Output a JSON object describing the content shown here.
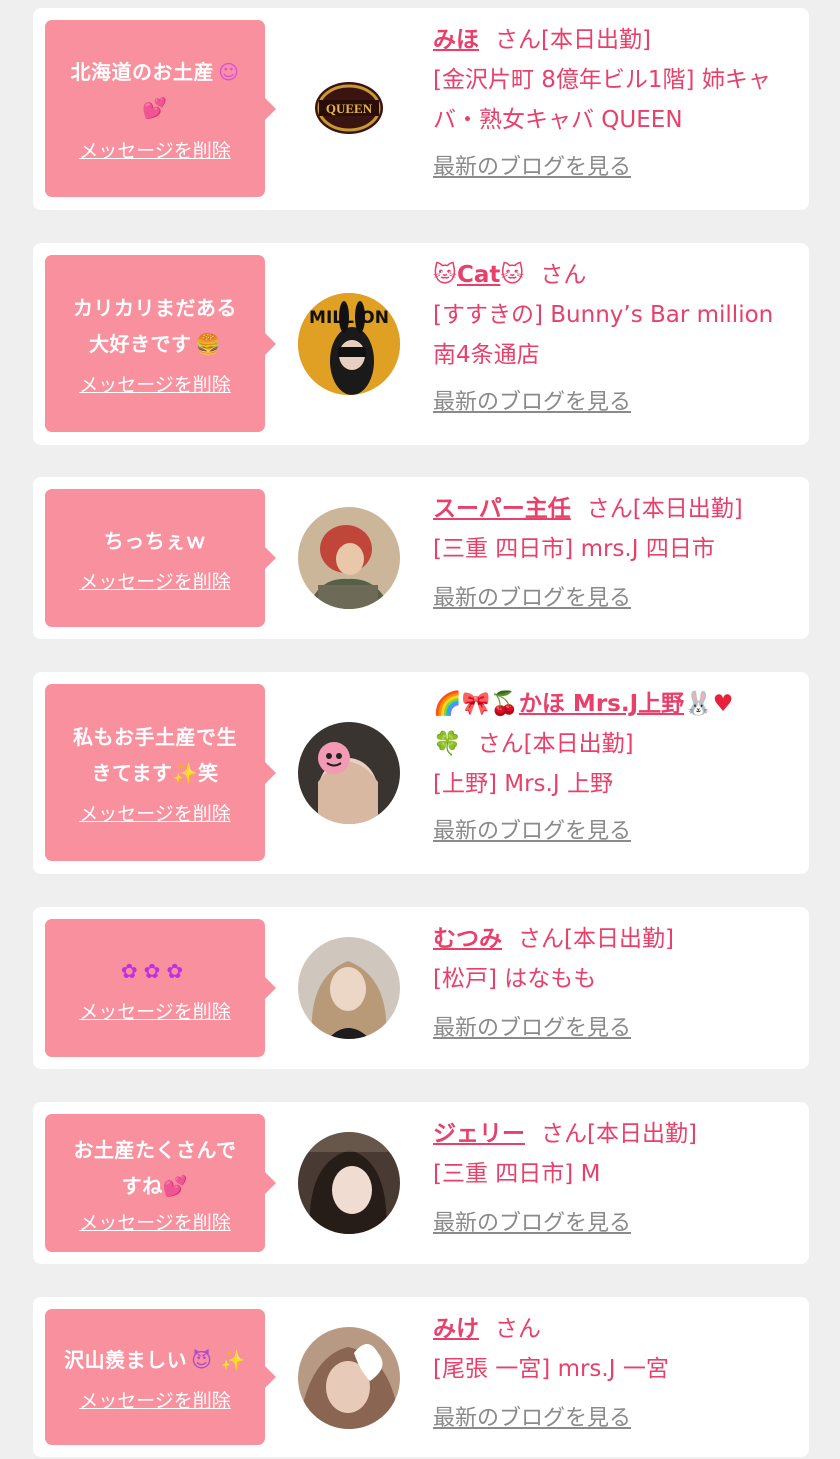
{
  "delete_label": "メッセージを削除",
  "blog_label": "最新のブログを見る",
  "accent_color": "#e8406a",
  "bubble_color": "#f8909e",
  "entries": [
    {
      "message_line1": "北海道のお土産",
      "message_line2": "",
      "message_emoji": "☺",
      "message_emoji2": "💕",
      "name": "みほ",
      "suffix": "さん[本日出勤]",
      "shop": "[金沢片町 8億年ビル1階] 姉キャバ・熟女キャバ QUEEN",
      "avatar": "QUEEN"
    },
    {
      "message_line1": "カリカリまだある",
      "message_line2": "大好きです",
      "message_emoji": "🍔",
      "name": "Cat",
      "name_prefix": "🐱",
      "name_suffix": "🐱",
      "suffix": "さん",
      "shop": "[すすきの] Bunny’s Bar million 南4条通店",
      "avatar": "MILLION"
    },
    {
      "message_line1": "ちっちぇｗ",
      "name": "スーパー主任",
      "suffix": "さん[本日出勤]",
      "shop": "[三重 四日市] mrs.J 四日市"
    },
    {
      "message_line1": "私もお手土産で生",
      "message_line2": "きてます",
      "message_emoji": "✨",
      "message_tail": "笑",
      "name_prefix": "🌈🎀🍒",
      "name": "かほ Mrs.J上野",
      "name_suffix": "🐰♥",
      "name_prefix2": "🍀",
      "suffix": "さん[本日出勤]",
      "shop": "[上野] Mrs.J 上野"
    },
    {
      "message_line1": "✿✿✿",
      "name": "むつみ",
      "suffix": "さん[本日出勤]",
      "shop": "[松戸] はなもも"
    },
    {
      "message_line1": "お土産たくさんで",
      "message_line2": "すね",
      "message_emoji": "💕",
      "name": "ジェリー",
      "suffix": "さん[本日出勤]",
      "shop": "[三重 四日市] M"
    },
    {
      "message_line1": "沢山羨ましい",
      "message_emoji": "😈",
      "message_emoji2": "✨",
      "name": "みけ",
      "suffix": "さん",
      "shop": "[尾張 一宮] mrs.J 一宮"
    }
  ]
}
